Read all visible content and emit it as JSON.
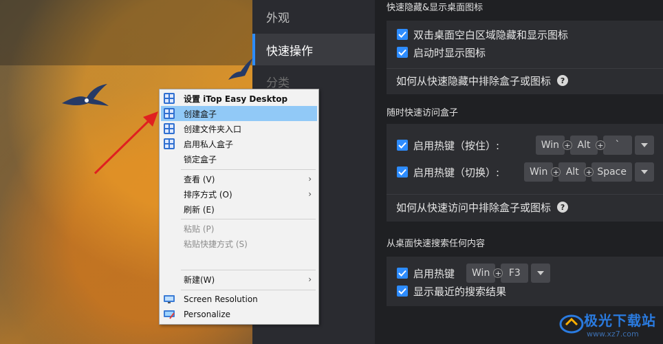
{
  "settings": {
    "nav": [
      {
        "label": "外观"
      },
      {
        "label": "快速操作"
      },
      {
        "label": "分类"
      }
    ],
    "section1": {
      "title": "快速隐藏&显示桌面图标",
      "opt1": "双击桌面空白区域隐藏和显示图标",
      "opt2": "启动时显示图标",
      "link": "如何从快速隐藏中排除盒子或图标"
    },
    "section2": {
      "title": "随时快速访问盒子",
      "opt1": "启用热键（按住）:",
      "opt1_keys": [
        "Win",
        "Alt",
        "`"
      ],
      "opt2": "启用热键（切换）:",
      "opt2_keys": [
        "Win",
        "Alt",
        "Space"
      ],
      "link": "如何从快速访问中排除盒子或图标"
    },
    "section3": {
      "title": "从桌面快速搜索任何内容",
      "opt1": "启用热键",
      "opt1_keys": [
        "Win",
        "F3"
      ],
      "opt2": "显示最近的搜索结果"
    }
  },
  "context_menu": {
    "items": [
      {
        "label": "设置 iTop Easy Desktop"
      },
      {
        "label": "创建盒子"
      },
      {
        "label": "创建文件夹入口"
      },
      {
        "label": "启用私人盒子"
      },
      {
        "label": "锁定盒子"
      },
      {
        "label": "查看 (V)"
      },
      {
        "label": "排序方式 (O)"
      },
      {
        "label": "刷新 (E)"
      },
      {
        "label": "粘贴 (P)"
      },
      {
        "label": "粘贴快捷方式 (S)"
      },
      {
        "label": "新建(W)"
      },
      {
        "label": "Screen Resolution"
      },
      {
        "label": "Personalize"
      }
    ]
  },
  "watermark": {
    "name": "极光下载站",
    "url": "www.xz7.com"
  },
  "colors": {
    "accent": "#2d8cff",
    "menu_highlight": "#91c9f7",
    "arrow": "#e02020"
  },
  "icons": [
    "itop-app-icon",
    "help-icon",
    "checkbox-checked-icon",
    "chevron-right-icon",
    "dropdown-arrow-icon",
    "monitor-icon",
    "personalize-icon"
  ]
}
